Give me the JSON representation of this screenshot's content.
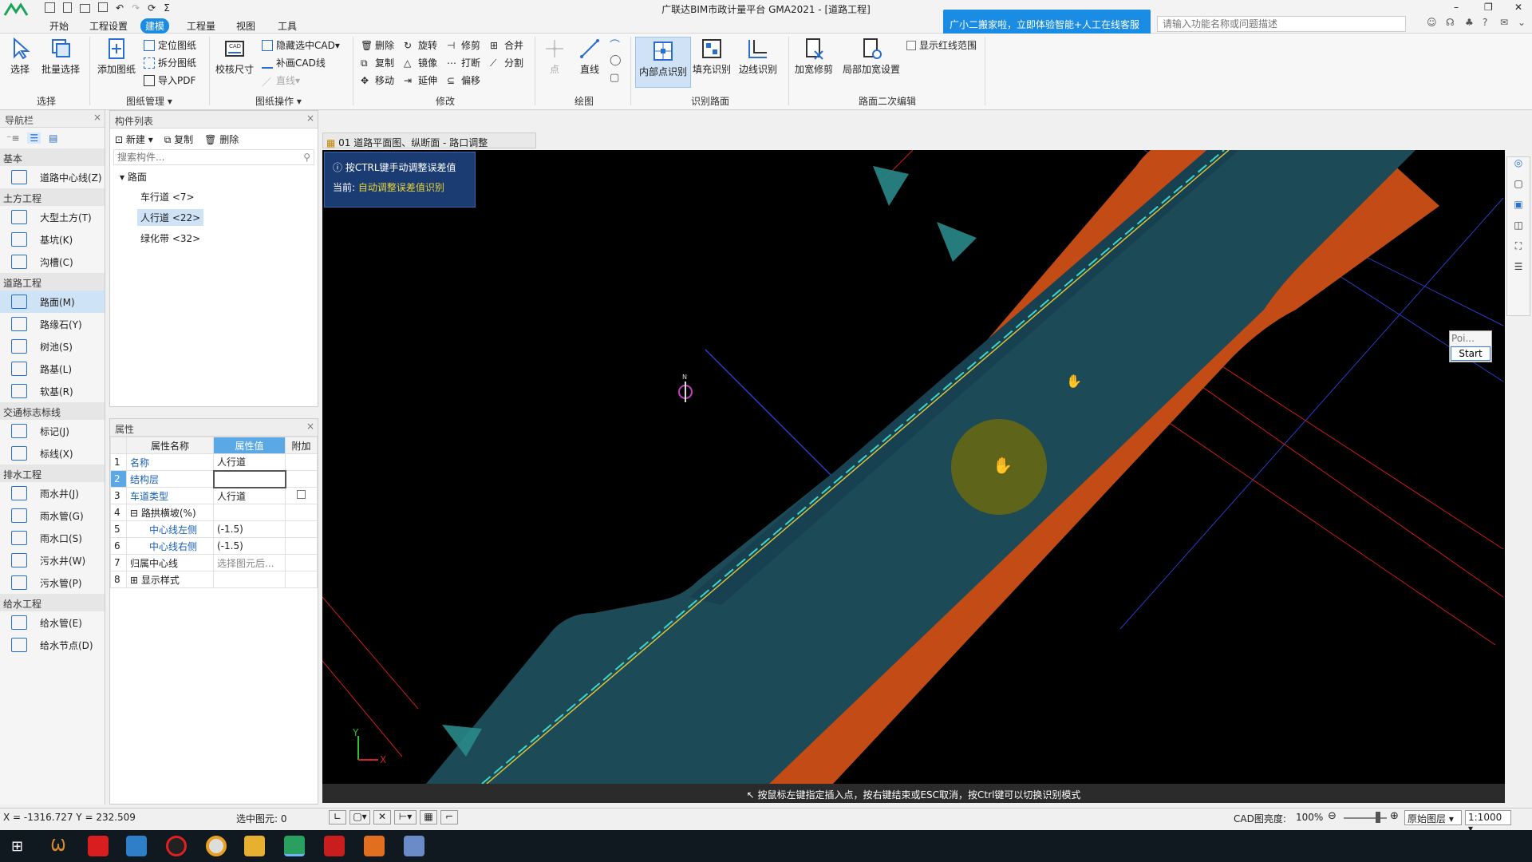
{
  "app": {
    "title": "广联达BIM市政计量平台 GMA2021 - [道路工程]"
  },
  "menu": {
    "items": [
      "开始",
      "工程设置",
      "建模",
      "工程量",
      "视图",
      "工具"
    ],
    "active_index": 2
  },
  "banner": {
    "text": "广小二搬家啦，立即体验智能+人工在线客服"
  },
  "search": {
    "placeholder": "请输入功能名称或问题描述"
  },
  "ribbon": {
    "select": {
      "select": "选择",
      "batch": "批量选择",
      "group": "选择"
    },
    "drawing_mgmt": {
      "add": "添加图纸",
      "locate": "定位图纸",
      "split": "拆分图纸",
      "import_pdf": "导入PDF",
      "group": "图纸管理"
    },
    "drawing_ops": {
      "calibrate": "校核尺寸",
      "hide_cad": "隐藏选中CAD",
      "add_cad_line": "补画CAD线",
      "line": "直线",
      "group": "图纸操作"
    },
    "modify": {
      "delete": "删除",
      "rotate": "旋转",
      "trim": "修剪",
      "merge": "合并",
      "copy": "复制",
      "mirror": "镜像",
      "break": "打断",
      "split": "分割",
      "move": "移动",
      "extend": "延伸",
      "offset": "偏移",
      "group": "修改"
    },
    "draw": {
      "point": "点",
      "line": "直线",
      "group": "绘图"
    },
    "identify": {
      "inner": "内部点识别",
      "fill": "填充识别",
      "edge": "边线识别",
      "group": "识别路面"
    },
    "secondary": {
      "widen": "加宽修剪",
      "local": "局部加宽设置",
      "show_red": "显示红线范围",
      "group": "路面二次编辑"
    }
  },
  "nav": {
    "title": "导航栏",
    "sections": [
      {
        "name": "基本",
        "items": [
          {
            "label": "道路中心线(Z)",
            "icon": "centerline-icon"
          }
        ]
      },
      {
        "name": "土方工程",
        "items": [
          {
            "label": "大型土方(T)",
            "icon": "earthwork-icon"
          },
          {
            "label": "基坑(K)",
            "icon": "pit-icon"
          },
          {
            "label": "沟槽(C)",
            "icon": "trench-icon"
          }
        ]
      },
      {
        "name": "道路工程",
        "items": [
          {
            "label": "路面(M)",
            "icon": "pavement-icon"
          },
          {
            "label": "路缘石(Y)",
            "icon": "curb-icon"
          },
          {
            "label": "树池(S)",
            "icon": "tree-pit-icon"
          },
          {
            "label": "路基(L)",
            "icon": "subgrade-icon"
          },
          {
            "label": "软基(R)",
            "icon": "soft-base-icon"
          }
        ]
      },
      {
        "name": "交通标志标线",
        "items": [
          {
            "label": "标记(J)",
            "icon": "marking-icon"
          },
          {
            "label": "标线(X)",
            "icon": "line-marking-icon"
          }
        ]
      },
      {
        "name": "排水工程",
        "items": [
          {
            "label": "雨水井(J)",
            "icon": "rain-well-icon"
          },
          {
            "label": "雨水管(G)",
            "icon": "rain-pipe-icon"
          },
          {
            "label": "雨水口(S)",
            "icon": "rain-inlet-icon"
          },
          {
            "label": "污水井(W)",
            "icon": "sewage-well-icon"
          },
          {
            "label": "污水管(P)",
            "icon": "sewage-pipe-icon"
          }
        ]
      },
      {
        "name": "给水工程",
        "items": [
          {
            "label": "给水管(E)",
            "icon": "water-pipe-icon"
          },
          {
            "label": "给水节点(D)",
            "icon": "water-node-icon"
          }
        ]
      }
    ],
    "selected": "路面(M)"
  },
  "components": {
    "title": "构件列表",
    "new": "新建",
    "copy": "复制",
    "delete": "删除",
    "search_placeholder": "搜索构件...",
    "root": "路面",
    "children": [
      "车行道 <7>",
      "人行道 <22>",
      "绿化带 <32>"
    ],
    "selected_index": 1
  },
  "properties": {
    "title": "属性",
    "headers": [
      "属性名称",
      "属性值",
      "附加"
    ],
    "rows": [
      {
        "n": "1",
        "name": "名称",
        "value": "人行道"
      },
      {
        "n": "2",
        "name": "结构层",
        "value": ""
      },
      {
        "n": "3",
        "name": "车道类型",
        "value": "人行道"
      },
      {
        "n": "4",
        "name": "路拱横坡(%)",
        "value": ""
      },
      {
        "n": "5",
        "name": "中心线左侧",
        "value": "(-1.5)"
      },
      {
        "n": "6",
        "name": "中心线右侧",
        "value": "(-1.5)"
      },
      {
        "n": "7",
        "name": "归属中心线",
        "value": "选择图元后..."
      },
      {
        "n": "8",
        "name": "显示样式",
        "value": ""
      }
    ]
  },
  "document_tab": {
    "label": "01 道路平面图、纵断面 - 路口调整"
  },
  "canvas": {
    "hint_title": "按CTRL键手动调整误差值",
    "hint_current_label": "当前:",
    "hint_current_value": "自动调整误差值识别",
    "bottom_hint": "按鼠标左键指定插入点，按右键结束或ESC取消，按Ctrl键可以切换识别模式",
    "poi_placeholder": "Poi...",
    "start_button": "Start",
    "compass": "N",
    "axis_x": "X",
    "axis_y": "Y"
  },
  "status": {
    "coords": "X = -1316.727 Y = 232.509",
    "selected": "选中图元: 0",
    "cad_brightness_label": "CAD图亮度:",
    "cad_brightness": "100%",
    "layer": "原始图层",
    "scale": "1:1000"
  },
  "colors": {
    "accent": "#1b8ce3",
    "road_fill": "#1d4a57",
    "curb": "#c24b16",
    "redline": "#d01818",
    "hint_bg": "#1b3c73"
  }
}
